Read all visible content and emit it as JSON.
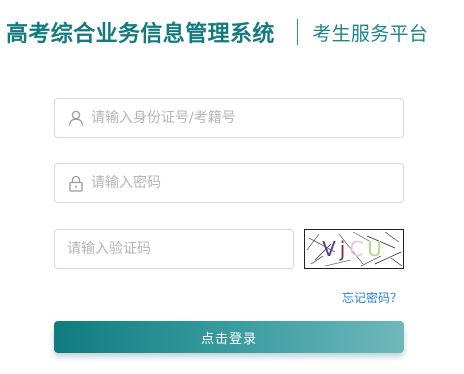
{
  "header": {
    "system_title": "高考综合业务信息管理系统",
    "platform_title": "考生服务平台"
  },
  "form": {
    "username": {
      "placeholder": "请输入身份证号/考籍号",
      "value": "",
      "icon": "user-icon"
    },
    "password": {
      "placeholder": "请输入密码",
      "value": "",
      "icon": "lock-icon"
    },
    "captcha_input": {
      "placeholder": "请输入验证码",
      "value": ""
    },
    "captcha_image_text": [
      "V",
      "j",
      "C",
      "U"
    ],
    "forgot_password": "忘记密码？",
    "login_button": "点击登录"
  },
  "colors": {
    "brand": "#137b7f",
    "link": "#2f7fd6",
    "button_start": "#0f7c80",
    "button_end": "#6fb8bb",
    "input_border": "#d9d9d9"
  }
}
